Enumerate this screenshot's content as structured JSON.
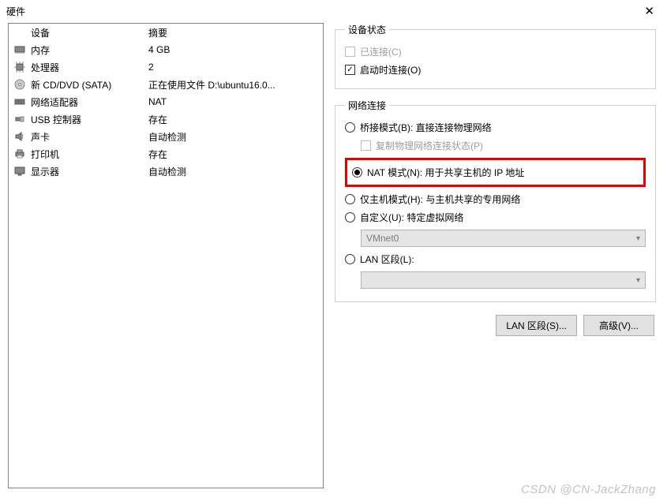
{
  "window": {
    "title": "硬件",
    "close_symbol": "✕"
  },
  "hw_table": {
    "headers": {
      "device": "设备",
      "summary": "摘要"
    },
    "rows": [
      {
        "icon": "memory",
        "name": "内存",
        "summary": "4 GB"
      },
      {
        "icon": "cpu",
        "name": "处理器",
        "summary": "2"
      },
      {
        "icon": "cd",
        "name": "新 CD/DVD (SATA)",
        "summary": "正在使用文件 D:\\ubuntu16.0..."
      },
      {
        "icon": "net",
        "name": "网络适配器",
        "summary": "NAT"
      },
      {
        "icon": "usb",
        "name": "USB 控制器",
        "summary": "存在"
      },
      {
        "icon": "sound",
        "name": "声卡",
        "summary": "自动检测"
      },
      {
        "icon": "printer",
        "name": "打印机",
        "summary": "存在"
      },
      {
        "icon": "display",
        "name": "显示器",
        "summary": "自动检测"
      }
    ]
  },
  "status_group": {
    "legend": "设备状态",
    "connected": {
      "label": "已连接(C)",
      "checked": false,
      "disabled": true
    },
    "connect_on_power": {
      "label": "启动时连接(O)",
      "checked": true,
      "disabled": false
    }
  },
  "net_group": {
    "legend": "网络连接",
    "bridged": {
      "label": "桥接模式(B): 直接连接物理网络"
    },
    "replicate": {
      "label": "复制物理网络连接状态(P)"
    },
    "nat": {
      "label": "NAT 模式(N): 用于共享主机的 IP 地址"
    },
    "hostonly": {
      "label": "仅主机模式(H): 与主机共享的专用网络"
    },
    "custom": {
      "label": "自定义(U): 特定虚拟网络"
    },
    "custom_value": "VMnet0",
    "lan": {
      "label": "LAN 区段(L):"
    },
    "lan_value": ""
  },
  "buttons": {
    "lan_segments": "LAN 区段(S)...",
    "advanced": "高级(V)..."
  },
  "watermark": "CSDN @CN-JackZhang"
}
